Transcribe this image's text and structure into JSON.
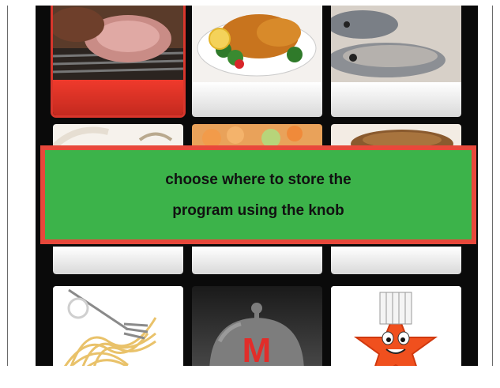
{
  "message": {
    "line1": "choose where to store the",
    "line2": "program using the knob"
  },
  "tiles": [
    {
      "name": "roast-meat",
      "selected": true
    },
    {
      "name": "roast-chicken",
      "selected": false
    },
    {
      "name": "fish",
      "selected": false
    },
    {
      "name": "row2-left",
      "selected": false
    },
    {
      "name": "row2-middle",
      "selected": false
    },
    {
      "name": "row2-right",
      "selected": false
    },
    {
      "name": "spaghetti",
      "selected": false
    },
    {
      "name": "memory-program",
      "selected": false
    },
    {
      "name": "chef-star",
      "selected": false
    }
  ],
  "memory_tile": {
    "letter": "M"
  },
  "colors": {
    "accent_red": "#e8483b",
    "message_green": "#3cb34a"
  }
}
